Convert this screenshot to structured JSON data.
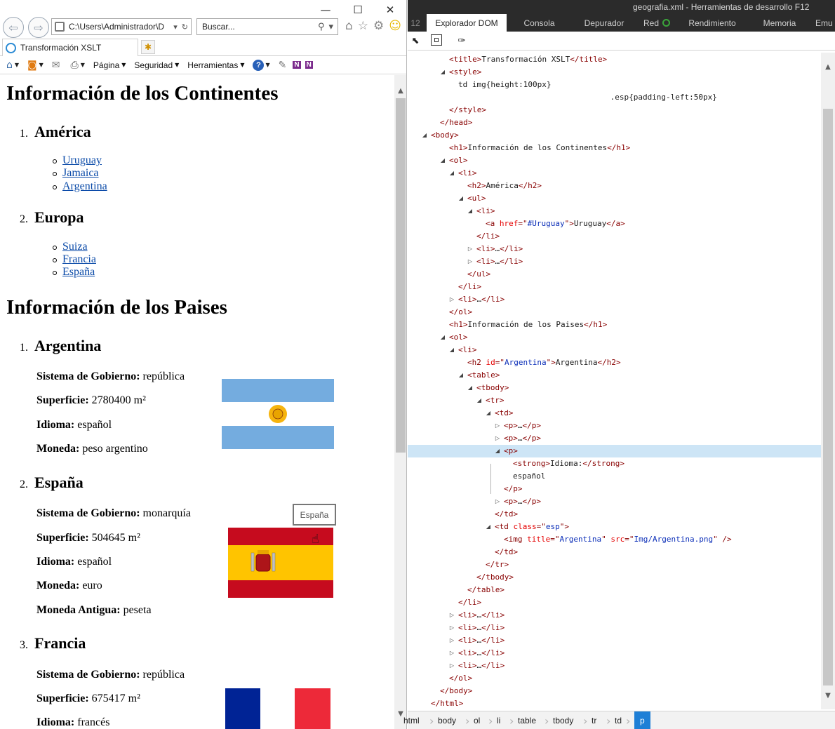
{
  "browser": {
    "window_controls": {
      "minimize": "—",
      "maximize": "☐",
      "close": "✕"
    },
    "address": "C:\\Users\\Administrador\\D",
    "search_placeholder": "Buscar...",
    "tab_title": "Transformación XSLT",
    "command_bar": {
      "menus": [
        "Página",
        "Seguridad",
        "Herramientas"
      ]
    },
    "page": {
      "h1_continents": "Información de los Continentes",
      "continents": [
        {
          "num": "1.",
          "name": "América",
          "links": [
            "Uruguay",
            "Jamaica",
            "Argentina"
          ]
        },
        {
          "num": "2.",
          "name": "Europa",
          "links": [
            "Suiza",
            "Francia",
            "España"
          ]
        }
      ],
      "h1_countries": "Información de los Paises",
      "countries": [
        {
          "num": "1.",
          "name": "Argentina",
          "props": [
            {
              "label": "Sistema de Gobierno:",
              "value": "república"
            },
            {
              "label": "Superficie:",
              "value": "2780400 m²"
            },
            {
              "label": "Idioma:",
              "value": "español"
            },
            {
              "label": "Moneda:",
              "value": "peso argentino"
            }
          ]
        },
        {
          "num": "2.",
          "name": "España",
          "props": [
            {
              "label": "Sistema de Gobierno:",
              "value": "monarquía"
            },
            {
              "label": "Superficie:",
              "value": "504645 m²"
            },
            {
              "label": "Idioma:",
              "value": "español"
            },
            {
              "label": "Moneda:",
              "value": "euro"
            },
            {
              "label": "Moneda Antigua:",
              "value": "peseta"
            }
          ]
        },
        {
          "num": "3.",
          "name": "Francia",
          "props": [
            {
              "label": "Sistema de Gobierno:",
              "value": "república"
            },
            {
              "label": "Superficie:",
              "value": "675417 m²"
            },
            {
              "label": "Idioma:",
              "value": "francés"
            }
          ]
        }
      ],
      "tooltip": "España"
    }
  },
  "devtools": {
    "title": "geografia.xml - Herramientas de desarrollo F12",
    "tabs": [
      "Explorador DOM",
      "Consola",
      "Depurador",
      "Red",
      "Rendimiento",
      "Memoria",
      "Emu"
    ],
    "active_tab": "Explorador DOM",
    "dom_lines": [
      {
        "tri": "",
        "parts": [
          [
            "t",
            "<title>"
          ],
          [
            "x",
            "Transformación XSLT"
          ],
          [
            "t",
            "</title>"
          ]
        ]
      },
      {
        "tri": "open",
        "parts": [
          [
            "t",
            "<style>"
          ]
        ]
      },
      {
        "tri": "",
        "parts": [
          [
            "x",
            "td img{height:100px}"
          ]
        ]
      },
      {
        "tri": "",
        "parts": [
          [
            "x",
            "                 .esp{padding-left:50px}"
          ]
        ]
      },
      {
        "tri": "",
        "parts": [
          [
            "t",
            "</style>"
          ]
        ]
      },
      {
        "tri": "",
        "parts": [
          [
            "t",
            "</head>"
          ]
        ]
      },
      {
        "tri": "open",
        "parts": [
          [
            "t",
            "<body>"
          ]
        ]
      },
      {
        "tri": "",
        "parts": [
          [
            "t",
            "<h1>"
          ],
          [
            "x",
            "Información de los Continentes"
          ],
          [
            "t",
            "</h1>"
          ]
        ]
      },
      {
        "tri": "open",
        "parts": [
          [
            "t",
            "<ol>"
          ]
        ]
      },
      {
        "tri": "open",
        "parts": [
          [
            "t",
            "<li>"
          ]
        ]
      },
      {
        "tri": "",
        "parts": [
          [
            "t",
            "<h2>"
          ],
          [
            "x",
            "América"
          ],
          [
            "t",
            "</h2>"
          ]
        ]
      },
      {
        "tri": "open",
        "parts": [
          [
            "t",
            "<ul>"
          ]
        ]
      },
      {
        "tri": "open",
        "parts": [
          [
            "t",
            "<li>"
          ]
        ]
      },
      {
        "tri": "",
        "parts": [
          [
            "t",
            "<a "
          ],
          [
            "a",
            "href"
          ],
          [
            "t",
            "=\""
          ],
          [
            "v",
            "#Uruguay"
          ],
          [
            "t",
            "\">"
          ],
          [
            "x",
            "Uruguay"
          ],
          [
            "t",
            "</a>"
          ]
        ]
      },
      {
        "tri": "",
        "parts": [
          [
            "t",
            "</li>"
          ]
        ]
      },
      {
        "tri": "closed",
        "parts": [
          [
            "t",
            "<li>"
          ],
          [
            "x",
            "…"
          ],
          [
            "t",
            "</li>"
          ]
        ]
      },
      {
        "tri": "closed",
        "parts": [
          [
            "t",
            "<li>"
          ],
          [
            "x",
            "…"
          ],
          [
            "t",
            "</li>"
          ]
        ]
      },
      {
        "tri": "",
        "parts": [
          [
            "t",
            "</ul>"
          ]
        ]
      },
      {
        "tri": "",
        "parts": [
          [
            "t",
            "</li>"
          ]
        ]
      },
      {
        "tri": "closed",
        "parts": [
          [
            "t",
            "<li>"
          ],
          [
            "x",
            "…"
          ],
          [
            "t",
            "</li>"
          ]
        ]
      },
      {
        "tri": "",
        "parts": [
          [
            "t",
            "</ol>"
          ]
        ]
      },
      {
        "tri": "",
        "parts": [
          [
            "t",
            "<h1>"
          ],
          [
            "x",
            "Información de los Paises"
          ],
          [
            "t",
            "</h1>"
          ]
        ]
      },
      {
        "tri": "open",
        "parts": [
          [
            "t",
            "<ol>"
          ]
        ]
      },
      {
        "tri": "open",
        "parts": [
          [
            "t",
            "<li>"
          ]
        ]
      },
      {
        "tri": "",
        "parts": [
          [
            "t",
            "<h2 "
          ],
          [
            "a",
            "id"
          ],
          [
            "t",
            "=\""
          ],
          [
            "v",
            "Argentina"
          ],
          [
            "t",
            "\">"
          ],
          [
            "x",
            "Argentina"
          ],
          [
            "t",
            "</h2>"
          ]
        ]
      },
      {
        "tri": "open",
        "parts": [
          [
            "t",
            "<table>"
          ]
        ]
      },
      {
        "tri": "open",
        "parts": [
          [
            "t",
            "<tbody>"
          ]
        ]
      },
      {
        "tri": "open",
        "parts": [
          [
            "t",
            "<tr>"
          ]
        ]
      },
      {
        "tri": "open",
        "parts": [
          [
            "t",
            "<td>"
          ]
        ]
      },
      {
        "tri": "closed",
        "parts": [
          [
            "t",
            "<p>"
          ],
          [
            "x",
            "…"
          ],
          [
            "t",
            "</p>"
          ]
        ]
      },
      {
        "tri": "closed",
        "parts": [
          [
            "t",
            "<p>"
          ],
          [
            "x",
            "…"
          ],
          [
            "t",
            "</p>"
          ]
        ]
      },
      {
        "tri": "open",
        "parts": [
          [
            "t",
            "<p>"
          ]
        ]
      },
      {
        "tri": "",
        "parts": [
          [
            "t",
            "<strong>"
          ],
          [
            "x",
            "Idioma:"
          ],
          [
            "t",
            "</strong>"
          ]
        ]
      },
      {
        "tri": "",
        "parts": [
          [
            "x",
            "español"
          ]
        ]
      },
      {
        "tri": "",
        "parts": [
          [
            "t",
            "</p>"
          ]
        ]
      },
      {
        "tri": "closed",
        "parts": [
          [
            "t",
            "<p>"
          ],
          [
            "x",
            "…"
          ],
          [
            "t",
            "</p>"
          ]
        ]
      },
      {
        "tri": "",
        "parts": [
          [
            "t",
            "</td>"
          ]
        ]
      },
      {
        "tri": "open",
        "parts": [
          [
            "t",
            "<td "
          ],
          [
            "a",
            "class"
          ],
          [
            "t",
            "=\""
          ],
          [
            "v",
            "esp"
          ],
          [
            "t",
            "\">"
          ]
        ]
      },
      {
        "tri": "",
        "parts": [
          [
            "t",
            "<img "
          ],
          [
            "a",
            "title"
          ],
          [
            "t",
            "=\""
          ],
          [
            "v",
            "Argentina"
          ],
          [
            "t",
            "\" "
          ],
          [
            "a",
            "src"
          ],
          [
            "t",
            "=\""
          ],
          [
            "v",
            "Img/Argentina.png"
          ],
          [
            "t",
            "\" />"
          ]
        ]
      },
      {
        "tri": "",
        "parts": [
          [
            "t",
            "</td>"
          ]
        ]
      },
      {
        "tri": "",
        "parts": [
          [
            "t",
            "</tr>"
          ]
        ]
      },
      {
        "tri": "",
        "parts": [
          [
            "t",
            "</tbody>"
          ]
        ]
      },
      {
        "tri": "",
        "parts": [
          [
            "t",
            "</table>"
          ]
        ]
      },
      {
        "tri": "",
        "parts": [
          [
            "t",
            "</li>"
          ]
        ]
      },
      {
        "tri": "closed",
        "parts": [
          [
            "t",
            "<li>"
          ],
          [
            "x",
            "…"
          ],
          [
            "t",
            "</li>"
          ]
        ]
      },
      {
        "tri": "closed",
        "parts": [
          [
            "t",
            "<li>"
          ],
          [
            "x",
            "…"
          ],
          [
            "t",
            "</li>"
          ]
        ]
      },
      {
        "tri": "closed",
        "parts": [
          [
            "t",
            "<li>"
          ],
          [
            "x",
            "…"
          ],
          [
            "t",
            "</li>"
          ]
        ]
      },
      {
        "tri": "closed",
        "parts": [
          [
            "t",
            "<li>"
          ],
          [
            "x",
            "…"
          ],
          [
            "t",
            "</li>"
          ]
        ]
      },
      {
        "tri": "closed",
        "parts": [
          [
            "t",
            "<li>"
          ],
          [
            "x",
            "…"
          ],
          [
            "t",
            "</li>"
          ]
        ]
      },
      {
        "tri": "",
        "parts": [
          [
            "t",
            "</ol>"
          ]
        ]
      },
      {
        "tri": "",
        "parts": [
          [
            "t",
            "</body>"
          ]
        ]
      },
      {
        "tri": "",
        "parts": [
          [
            "t",
            "</html>"
          ]
        ]
      }
    ],
    "breadcrumbs": [
      "html",
      "body",
      "ol",
      "li",
      "table",
      "tbody",
      "tr",
      "td",
      "p"
    ],
    "active_crumb": "p"
  }
}
